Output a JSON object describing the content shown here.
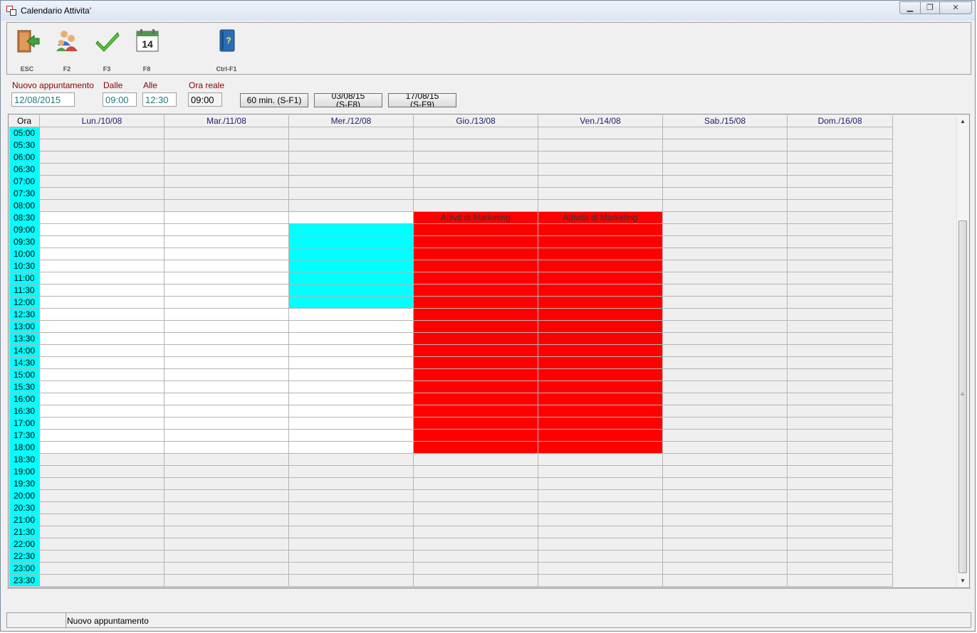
{
  "window": {
    "title": "Calendario Attivita'"
  },
  "toolbar": [
    {
      "key": "ESC",
      "icon": "exit-door-icon"
    },
    {
      "key": "F2",
      "icon": "users-group-icon"
    },
    {
      "key": "F3",
      "icon": "checkmark-icon"
    },
    {
      "key": "F8",
      "icon": "calendar-14-icon"
    },
    {
      "key": "Ctrl-F1",
      "icon": "help-book-icon"
    }
  ],
  "form": {
    "new_appointment_label": "Nuovo appuntamento",
    "new_appointment_value": "12/08/2015",
    "from_label": "Dalle",
    "from_value": "09:00",
    "to_label": "Alle",
    "to_value": "12:30",
    "real_time_label": "Ora reale",
    "real_time_value": "09:00",
    "interval_button": "60 min. (S-F1)",
    "prev_week_button_line1": "03/08/15",
    "prev_week_button_line2": "(S-F8)",
    "next_week_button_line1": "17/08/15",
    "next_week_button_line2": "(S-F9)"
  },
  "calendar": {
    "time_header": "Ora",
    "days": [
      "Lun./10/08",
      "Mar./11/08",
      "Mer./12/08",
      "Gio./13/08",
      "Ven./14/08",
      "Sab./15/08",
      "Dom./16/08"
    ],
    "times": [
      "05:00",
      "05:30",
      "06:00",
      "06:30",
      "07:00",
      "07:30",
      "08:00",
      "08:30",
      "09:00",
      "09:30",
      "10:00",
      "10:30",
      "11:00",
      "11:30",
      "12:00",
      "12:30",
      "13:00",
      "13:30",
      "14:00",
      "14:30",
      "15:00",
      "15:30",
      "16:00",
      "16:30",
      "17:00",
      "17:30",
      "18:00",
      "18:30",
      "19:00",
      "19:30",
      "20:00",
      "20:30",
      "21:00",
      "21:30",
      "22:00",
      "22:30",
      "23:00",
      "23:30"
    ],
    "working_hours": {
      "start": "08:30",
      "end": "18:00",
      "weekdays": [
        0,
        1,
        2,
        3,
        4
      ]
    },
    "appointments": [
      {
        "day": 2,
        "start": "09:00",
        "end": "12:00",
        "color": "#00ffff",
        "label": ""
      },
      {
        "day": 3,
        "start": "08:30",
        "end": "18:00",
        "color": "#ff0000",
        "label": "Attivit di Marketing"
      },
      {
        "day": 4,
        "start": "08:30",
        "end": "18:00",
        "color": "#ff0000",
        "label": "Attività di Marketing"
      }
    ]
  },
  "statusbar": {
    "text": "Nuovo appuntamento"
  },
  "colors": {
    "time_column": "#00ffff",
    "appointment_red": "#ff0000",
    "selection_cyan": "#00ffff",
    "label_text": "#8b0000"
  }
}
